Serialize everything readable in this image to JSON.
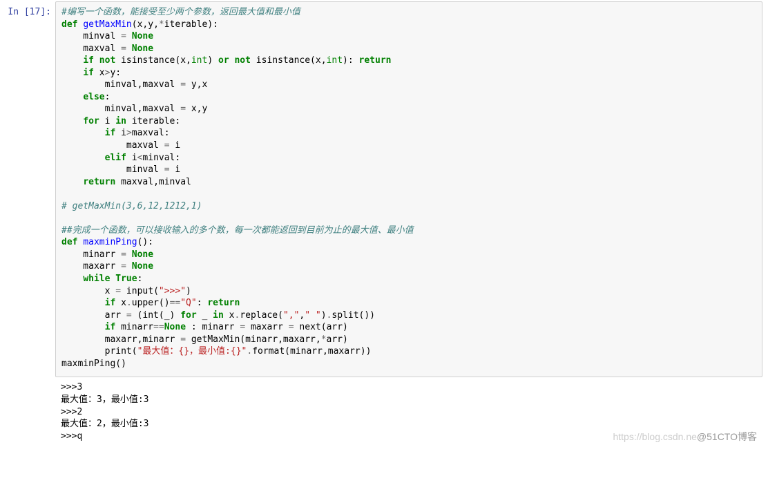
{
  "prompt": {
    "label": "In [17]:"
  },
  "code": {
    "l01": "#编写一个函数，能接受至少两个参数，返回最大值和最小值",
    "l02a": "def",
    "l02b": " ",
    "l02c": "getMaxMin",
    "l02d": "(x,y,",
    "l02e": "*",
    "l02f": "iterable):",
    "l03a": "    minval ",
    "l03b": "=",
    "l03c": " ",
    "l03d": "None",
    "l04a": "    maxval ",
    "l04b": "=",
    "l04c": " ",
    "l04d": "None",
    "l05a": "    ",
    "l05b": "if",
    "l05c": " ",
    "l05d": "not",
    "l05e": " isinstance(x,",
    "l05f": "int",
    "l05g": ") ",
    "l05h": "or",
    "l05i": " ",
    "l05j": "not",
    "l05k": " isinstance(x,",
    "l05l": "int",
    "l05m": "): ",
    "l05n": "return",
    "l06a": "    ",
    "l06b": "if",
    "l06c": " x",
    "l06d": ">",
    "l06e": "y:",
    "l07a": "        minval,maxval ",
    "l07b": "=",
    "l07c": " y,x",
    "l08a": "    ",
    "l08b": "else",
    "l08c": ":",
    "l09a": "        minval,maxval ",
    "l09b": "=",
    "l09c": " x,y",
    "l10a": "    ",
    "l10b": "for",
    "l10c": " i ",
    "l10d": "in",
    "l10e": " iterable:",
    "l11a": "        ",
    "l11b": "if",
    "l11c": " i",
    "l11d": ">",
    "l11e": "maxval:",
    "l12a": "            maxval ",
    "l12b": "=",
    "l12c": " i",
    "l13a": "        ",
    "l13b": "elif",
    "l13c": " i",
    "l13d": "<",
    "l13e": "minval:",
    "l14a": "            minval ",
    "l14b": "=",
    "l14c": " i",
    "l15a": "    ",
    "l15b": "return",
    "l15c": " maxval,minval",
    "l16": "",
    "l17": "# getMaxMin(3,6,12,1212,1)",
    "l18": "",
    "l19": "##完成一个函数，可以接收输入的多个数，每一次都能返回到目前为止的最大值、最小值",
    "l20a": "def",
    "l20b": " ",
    "l20c": "maxminPing",
    "l20d": "():",
    "l21a": "    minarr ",
    "l21b": "=",
    "l21c": " ",
    "l21d": "None",
    "l22a": "    maxarr ",
    "l22b": "=",
    "l22c": " ",
    "l22d": "None",
    "l23a": "    ",
    "l23b": "while",
    "l23c": " ",
    "l23d": "True",
    "l23e": ":",
    "l24a": "        x ",
    "l24b": "=",
    "l24c": " input(",
    "l24d": "\">>>\"",
    "l24e": ")",
    "l25a": "        ",
    "l25b": "if",
    "l25c": " x",
    "l25d": ".",
    "l25e": "upper()",
    "l25f": "==",
    "l25g": "\"Q\"",
    "l25h": ": ",
    "l25i": "return",
    "l26a": "        arr ",
    "l26b": "=",
    "l26c": " (int(_) ",
    "l26d": "for",
    "l26e": " _ ",
    "l26f": "in",
    "l26g": " x",
    "l26h": ".",
    "l26i": "replace(",
    "l26j": "\",\"",
    "l26k": ",",
    "l26l": "\" \"",
    "l26m": ")",
    "l26n": ".",
    "l26o": "split())",
    "l27a": "        ",
    "l27b": "if",
    "l27c": " minarr",
    "l27d": "==",
    "l27e": "None",
    "l27f": " : minarr ",
    "l27g": "=",
    "l27h": " maxarr ",
    "l27i": "=",
    "l27j": " next(arr)",
    "l28a": "        maxarr,minarr ",
    "l28b": "=",
    "l28c": " getMaxMin(minarr,maxarr,",
    "l28d": "*",
    "l28e": "arr)",
    "l29a": "        print(",
    "l29b": "\"最大值：{}，最小值:{}\"",
    "l29c": ".",
    "l29d": "format(minarr,maxarr))",
    "l30": "maxminPing()"
  },
  "output": {
    "l1": ">>>3",
    "l2": "最大值：3，最小值:3",
    "l3": ">>>2",
    "l4": "最大值：2，最小值:3",
    "l5": ">>>q"
  },
  "watermark": {
    "w1": "https://blog.csdn.ne",
    "w2": "@51CTO博客"
  }
}
